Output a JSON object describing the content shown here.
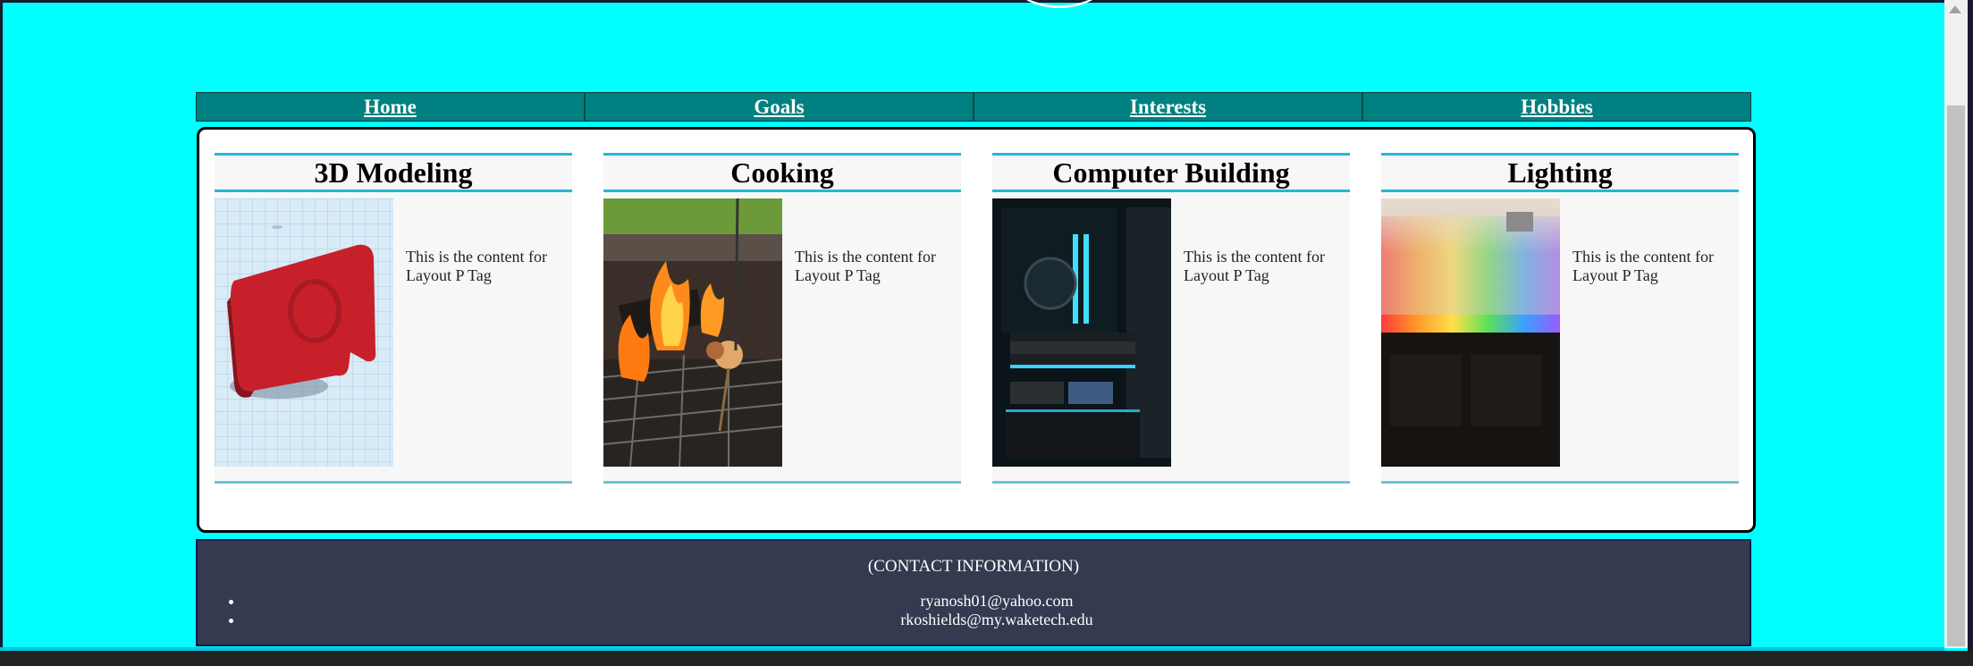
{
  "nav": {
    "items": [
      {
        "label": "Home"
      },
      {
        "label": "Goals"
      },
      {
        "label": "Interests"
      },
      {
        "label": "Hobbies"
      }
    ]
  },
  "cards": [
    {
      "title": "3D Modeling",
      "content": "This is the content for Layout P Tag",
      "image_icon": "3d-model-photo"
    },
    {
      "title": "Cooking",
      "content": "This is the content for Layout P Tag",
      "image_icon": "campfire-photo"
    },
    {
      "title": "Computer Building",
      "content": "This is the content for Layout P Tag",
      "image_icon": "pc-build-photo"
    },
    {
      "title": "Lighting",
      "content": "This is the content for Layout P Tag",
      "image_icon": "rainbow-lighting-photo"
    }
  ],
  "footer": {
    "heading": "(CONTACT INFORMATION)",
    "contacts": [
      "ryanosh01@yahoo.com",
      "rkoshields@my.waketech.edu"
    ]
  },
  "colors": {
    "page_background": "#00ffff",
    "nav_background": "#008080",
    "card_rule": "#26b5d8",
    "footer_background": "#343a50"
  }
}
